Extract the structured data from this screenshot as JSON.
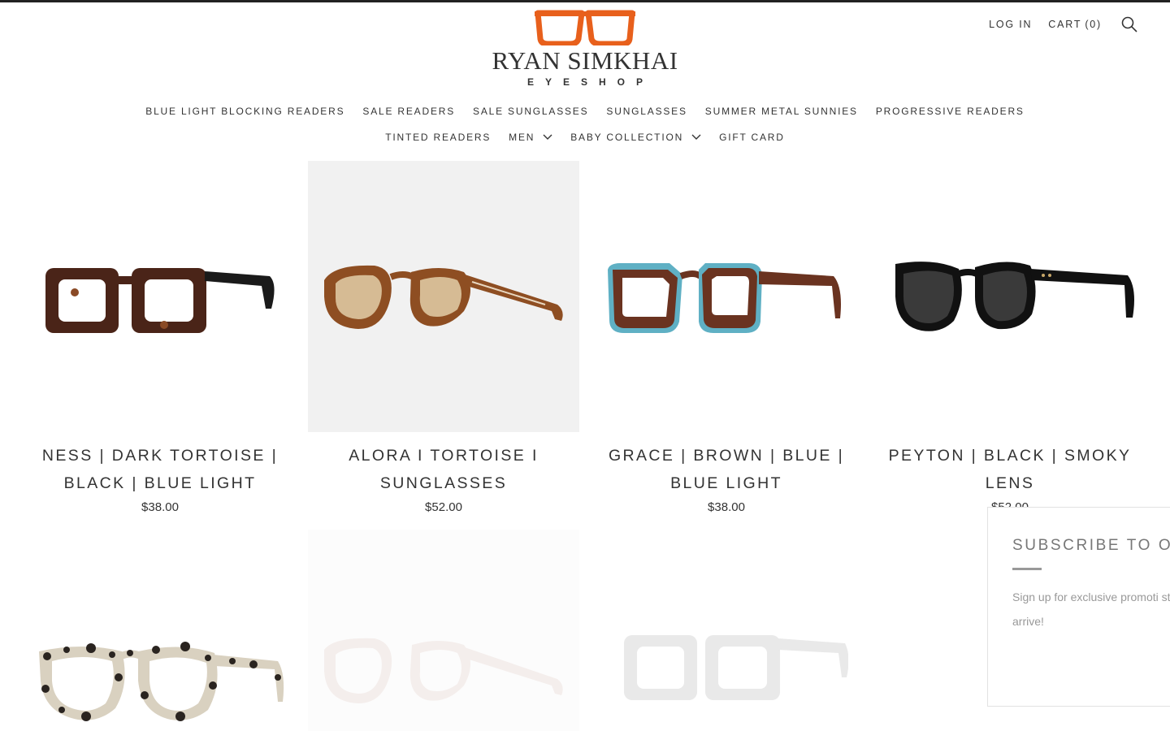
{
  "brand": {
    "name": "RYAN SIMKHAI",
    "subtitle": "EYESHOP",
    "accent": "#e8601c"
  },
  "header": {
    "login_label": "LOG IN",
    "cart_label": "CART",
    "cart_count": "(0)",
    "search_icon": "search-icon"
  },
  "nav": {
    "row1": [
      {
        "label": "BLUE LIGHT BLOCKING READERS"
      },
      {
        "label": "SALE READERS"
      },
      {
        "label": "SALE SUNGLASSES"
      },
      {
        "label": "SUNGLASSES"
      },
      {
        "label": "SUMMER METAL SUNNIES"
      },
      {
        "label": "PROGRESSIVE READERS"
      }
    ],
    "row2": [
      {
        "label": "TINTED READERS"
      },
      {
        "label": "MEN",
        "has_dropdown": true
      },
      {
        "label": "BABY COLLECTION",
        "has_dropdown": true
      },
      {
        "label": "GIFT CARD"
      }
    ]
  },
  "products": [
    {
      "title": "NESS | DARK TORTOISE | BLACK | BLUE LIGHT",
      "price": "$38.00",
      "line1": "NESS | DARK TORTOISE |",
      "line2": "BLACK | BLUE LIGHT"
    },
    {
      "title": "ALORA I TORTOISE I SUNGLASSES",
      "price": "$52.00",
      "line1": "ALORA I TORTOISE I",
      "line2": "SUNGLASSES"
    },
    {
      "title": "GRACE | BROWN | BLUE | BLUE LIGHT",
      "price": "$38.00",
      "line1": "GRACE | BROWN | BLUE |",
      "line2": "BLUE LIGHT"
    },
    {
      "title": "PEYTON | BLACK | SMOKY LENS",
      "price": "$52.00",
      "line1": "PEYTON | BLACK | SMOKY",
      "line2": "LENS"
    }
  ],
  "popup": {
    "title": "SUBSCRIBE TO O",
    "text": "Sign up for exclusive promoti styles arrive!"
  }
}
